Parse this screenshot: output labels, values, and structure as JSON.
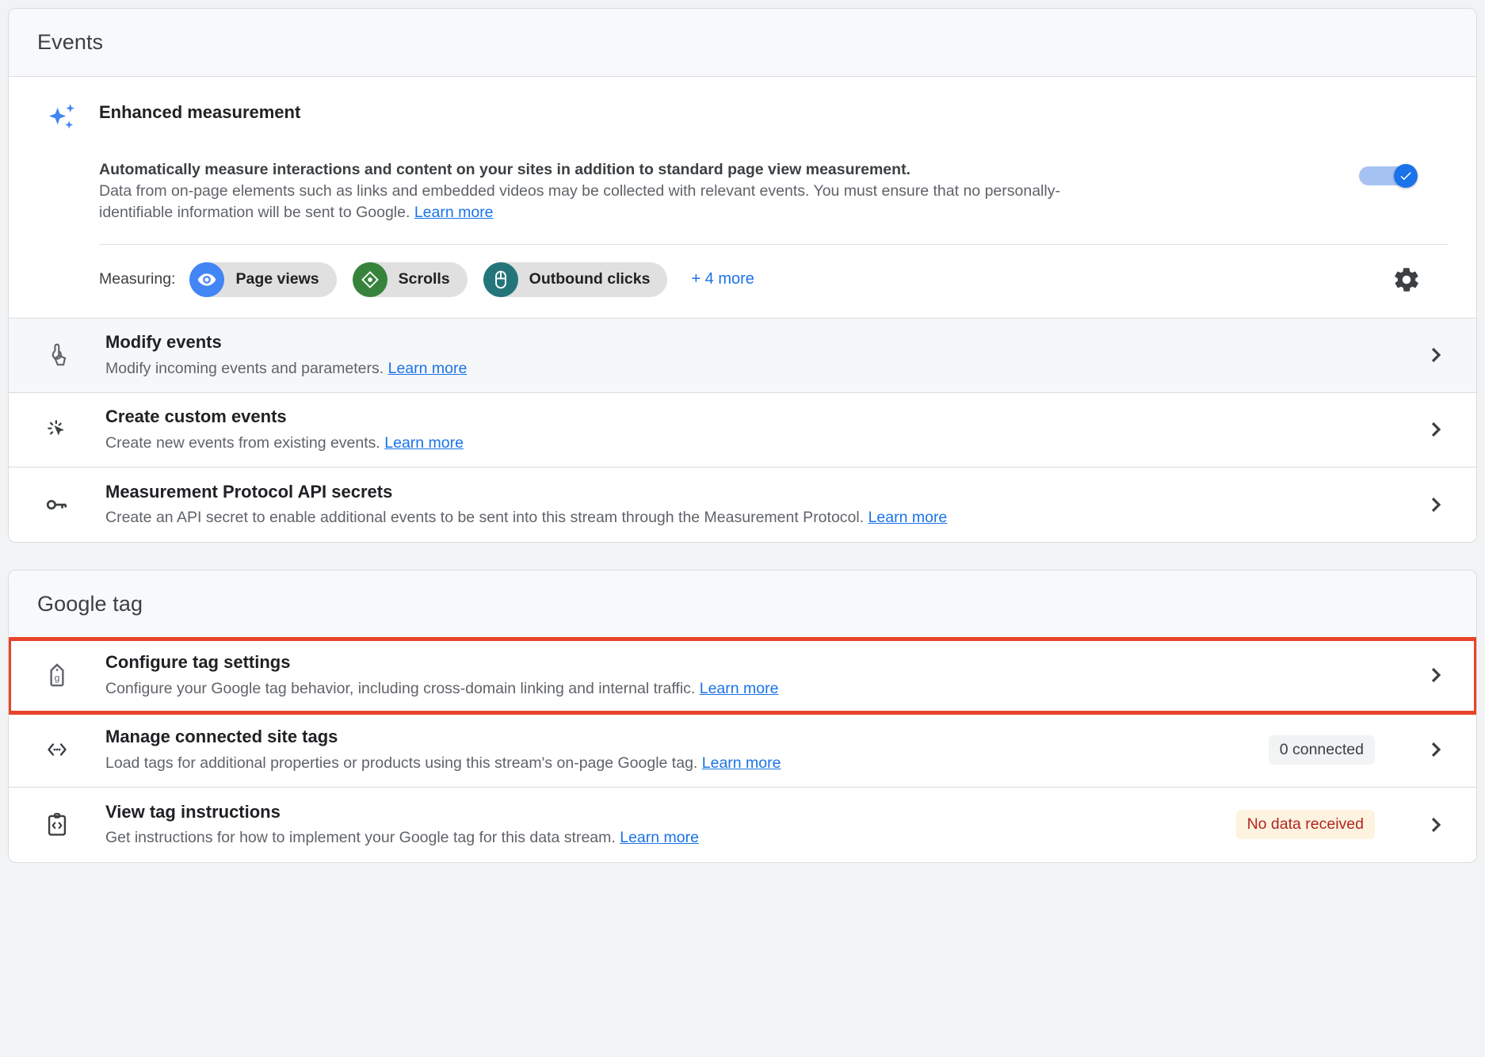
{
  "colors": {
    "accent_blue": "#1a73e8",
    "highlight_border": "#e8432a",
    "page_views_chip": "#4285f4",
    "scrolls_chip": "#37833b",
    "outbound_chip": "#24757a",
    "warn_badge_bg": "#fdf3e0",
    "warn_badge_text": "#b3261e"
  },
  "events_card": {
    "header_title": "Events",
    "enhanced_measurement": {
      "icon": "sparkle-icon",
      "title": "Enhanced measurement",
      "lead": "Automatically measure interactions and content on your sites in addition to standard page view measurement.",
      "description": "Data from on-page elements such as links and embedded videos may be collected with relevant events. You must ensure that no personally-identifiable information will be sent to Google. ",
      "learn_more": "Learn more",
      "toggle_on": true,
      "measuring_label": "Measuring:",
      "chips": [
        {
          "label": "Page views",
          "icon": "eye-icon",
          "color": "#4285f4"
        },
        {
          "label": "Scrolls",
          "icon": "scroll-diamond-icon",
          "color": "#37833b"
        },
        {
          "label": "Outbound clicks",
          "icon": "mouse-icon",
          "color": "#24757a"
        }
      ],
      "more_link": "+ 4 more",
      "settings_icon": "gear-icon"
    },
    "rows": [
      {
        "icon": "tap-hand-icon",
        "title": "Modify events",
        "subtitle": "Modify incoming events and parameters. ",
        "learn_more": "Learn more",
        "status": "",
        "status_kind": "",
        "hovered": true,
        "highlighted": false
      },
      {
        "icon": "click-cursor-icon",
        "title": "Create custom events",
        "subtitle": "Create new events from existing events. ",
        "learn_more": "Learn more",
        "status": "",
        "status_kind": "",
        "hovered": false,
        "highlighted": false
      },
      {
        "icon": "key-icon",
        "title": "Measurement Protocol API secrets",
        "subtitle": "Create an API secret to enable additional events to be sent into this stream through the Measurement Protocol. ",
        "learn_more": "Learn more",
        "status": "",
        "status_kind": "",
        "hovered": false,
        "highlighted": false
      }
    ]
  },
  "google_tag_card": {
    "header_title": "Google tag",
    "rows": [
      {
        "icon": "google-tag-icon",
        "title": "Configure tag settings",
        "subtitle": "Configure your Google tag behavior, including cross-domain linking and internal traffic. ",
        "learn_more": "Learn more",
        "status": "",
        "status_kind": "",
        "hovered": false,
        "highlighted": true
      },
      {
        "icon": "code-dots-icon",
        "title": "Manage connected site tags",
        "subtitle": "Load tags for additional properties or products using this stream's on-page Google tag. ",
        "learn_more": "Learn more",
        "status": "0 connected",
        "status_kind": "neutral",
        "hovered": false,
        "highlighted": false
      },
      {
        "icon": "clipboard-code-icon",
        "title": "View tag instructions",
        "subtitle": "Get instructions for how to implement your Google tag for this data stream. ",
        "learn_more": "Learn more",
        "status": "No data received",
        "status_kind": "warn",
        "hovered": false,
        "highlighted": false
      }
    ]
  }
}
